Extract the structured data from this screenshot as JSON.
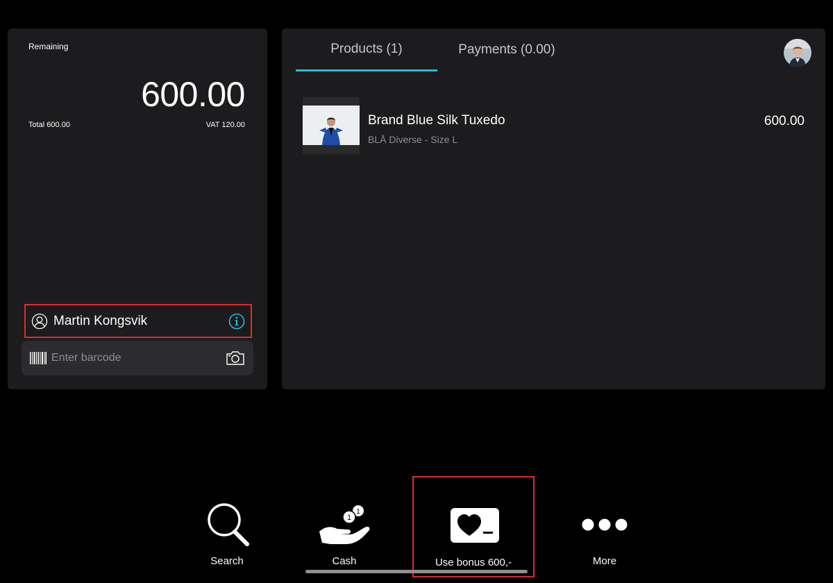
{
  "summary": {
    "remaining_label": "Remaining",
    "remaining_amount": "600.00",
    "total_text": "Total 600.00",
    "vat_text": "VAT 120.00"
  },
  "customer": {
    "name": "Martin Kongsvik",
    "user_icon": "user-circle-icon",
    "info_icon": "info-icon"
  },
  "barcode": {
    "placeholder": "Enter barcode",
    "value": "",
    "barcode_icon": "barcode-icon",
    "camera_icon": "camera-icon"
  },
  "tabs": [
    {
      "label": "Products (1)",
      "active": true
    },
    {
      "label": "Payments (0.00)",
      "active": false
    }
  ],
  "products": [
    {
      "title": "Brand Blue Silk Tuxedo",
      "subtitle": "BLÅ Diverse - Size L",
      "price": "600.00"
    }
  ],
  "bottom_bar": [
    {
      "label": "Search",
      "icon": "search-icon"
    },
    {
      "label": "Cash",
      "icon": "cash-hand-icon"
    },
    {
      "label": "Use bonus 600,-",
      "icon": "heart-card-icon"
    },
    {
      "label": "More",
      "icon": "more-dots-icon"
    }
  ],
  "colors": {
    "background": "#000000",
    "panel": "#1c1c1e",
    "accent": "#2fb8d6",
    "highlight_border": "#e02b2b"
  }
}
